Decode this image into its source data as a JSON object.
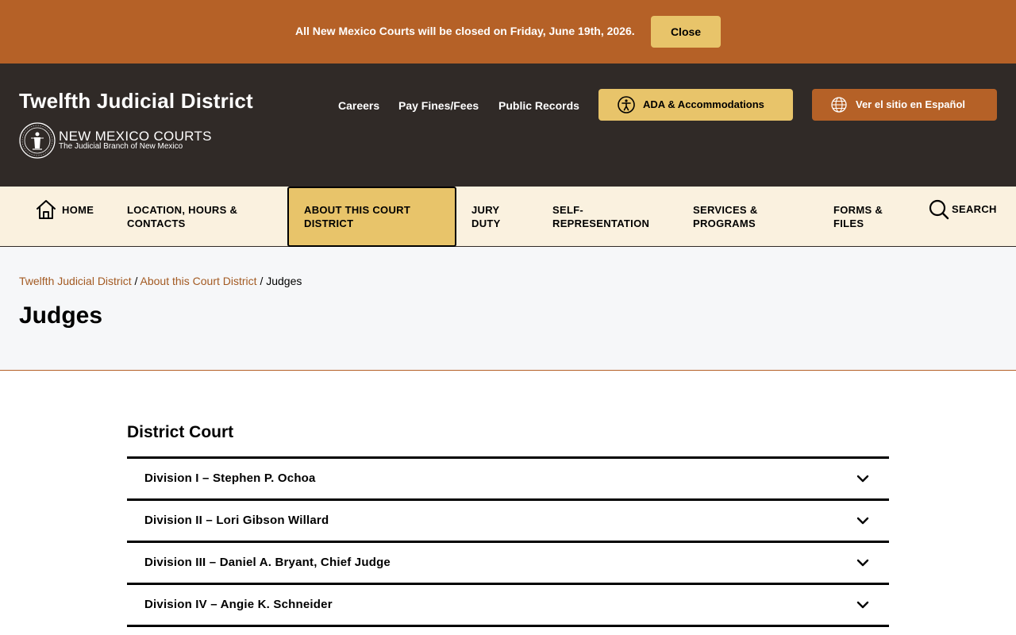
{
  "alert": {
    "message": "All New Mexico Courts will be closed on Friday, June 19th, 2026.",
    "close_label": "Close",
    "bg_color": "#B56127"
  },
  "header": {
    "site_title": "Twelfth Judicial District",
    "logo": {
      "name": "NEW MEXICO COURTS",
      "tagline": "The Judicial Branch of New Mexico",
      "seal_icon": "court-seal-icon"
    },
    "links": [
      {
        "label": "Careers"
      },
      {
        "label": "Pay Fines/Fees"
      },
      {
        "label": "Public Records"
      }
    ],
    "ada_button": {
      "label": "ADA & Accommodations",
      "icon": "accessibility-icon"
    },
    "spanish_button": {
      "label": "Ver el sitio en Español",
      "icon": "globe-icon"
    },
    "bg_color": "#302A27"
  },
  "nav": {
    "items": [
      {
        "label": "HOME",
        "icon": "home-icon"
      },
      {
        "label": "LOCATION, HOURS & CONTACTS"
      },
      {
        "label": "ABOUT THIS COURT DISTRICT",
        "active": true
      },
      {
        "label": "JURY DUTY"
      },
      {
        "label": "SELF-REPRESENTATION"
      },
      {
        "label": "SERVICES & PROGRAMS"
      },
      {
        "label": "FORMS & FILES"
      },
      {
        "label": "SEARCH",
        "icon": "search-icon"
      }
    ],
    "accent_color": "#E8C46A"
  },
  "breadcrumb": {
    "items": [
      {
        "label": "Twelfth Judicial District",
        "link": true
      },
      {
        "label": "About this Court District",
        "link": true
      },
      {
        "label": "Judges",
        "link": false
      }
    ],
    "separator": "/"
  },
  "page": {
    "title": "Judges"
  },
  "content": {
    "section_title": "District Court",
    "accordion": [
      {
        "label": "Division I – Stephen P. Ochoa",
        "icon": "chevron-down-icon"
      },
      {
        "label": "Division II – Lori Gibson Willard",
        "icon": "chevron-down-icon"
      },
      {
        "label": "Division III – Daniel A. Bryant, Chief Judge",
        "icon": "chevron-down-icon"
      },
      {
        "label": "Division IV – Angie K. Schneider",
        "icon": "chevron-down-icon"
      }
    ]
  }
}
